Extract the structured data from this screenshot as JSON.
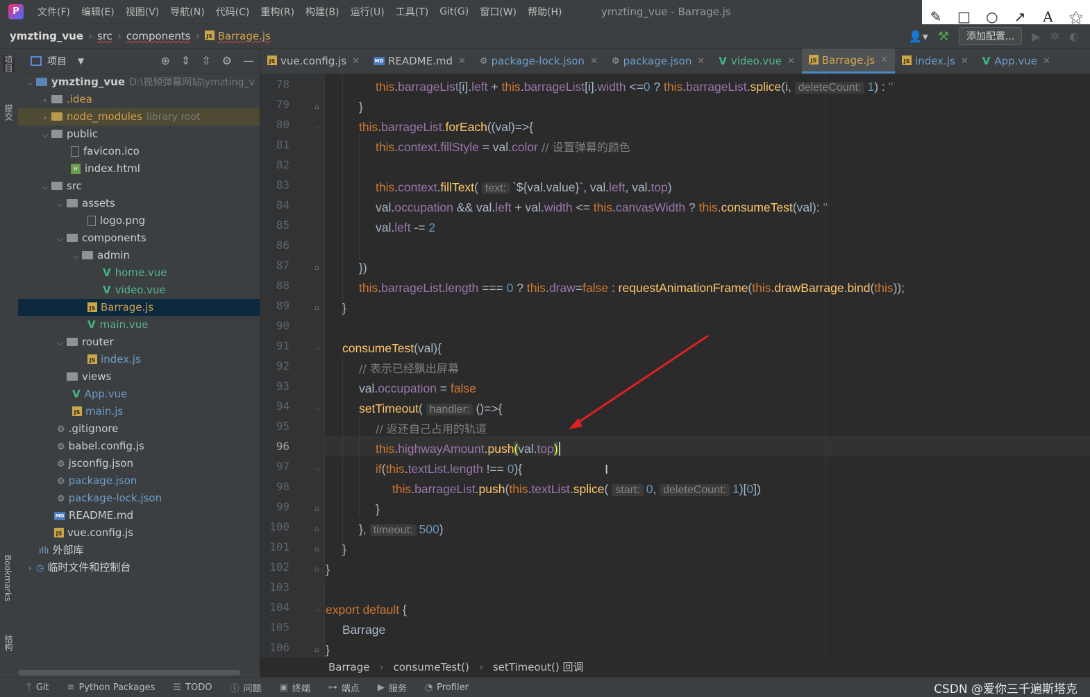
{
  "menubar": {
    "menus": [
      "文件(F)",
      "编辑(E)",
      "视图(V)",
      "导航(N)",
      "代码(C)",
      "重构(R)",
      "构建(B)",
      "运行(U)",
      "工具(T)",
      "Git(G)",
      "窗口(W)",
      "帮助(H)"
    ],
    "window_title": "ymzting_vue - Barrage.js"
  },
  "annotation_toolbar": {
    "tools": [
      "pencil-icon",
      "rectangle-icon",
      "circle-icon",
      "arrow-icon",
      "text-icon",
      "magic-wand-icon"
    ]
  },
  "navbar": {
    "crumbs": [
      "ymzting_vue",
      "src",
      "components",
      "Barrage.js"
    ],
    "add_config_label": "添加配置..."
  },
  "leftstrip": {
    "project": "项目",
    "commit": "提交",
    "bookmarks": "Bookmarks",
    "structure": "结构"
  },
  "project_panel": {
    "title": "项目",
    "tree": [
      {
        "name": "ymzting_vue",
        "extra": "D:\\视频弹幕网站\\ymzting_v"
      },
      {
        "name": ".idea"
      },
      {
        "name": "node_modules",
        "extra": "library root"
      },
      {
        "name": "public"
      },
      {
        "name": "favicon.ico"
      },
      {
        "name": "index.html"
      },
      {
        "name": "src"
      },
      {
        "name": "assets"
      },
      {
        "name": "logo.png"
      },
      {
        "name": "components"
      },
      {
        "name": "admin"
      },
      {
        "name": "home.vue"
      },
      {
        "name": "video.vue"
      },
      {
        "name": "Barrage.js"
      },
      {
        "name": "main.vue"
      },
      {
        "name": "router"
      },
      {
        "name": "index.js"
      },
      {
        "name": "views"
      },
      {
        "name": "App.vue"
      },
      {
        "name": "main.js"
      },
      {
        "name": ".gitignore"
      },
      {
        "name": "babel.config.js"
      },
      {
        "name": "jsconfig.json"
      },
      {
        "name": "package.json"
      },
      {
        "name": "package-lock.json"
      },
      {
        "name": "README.md"
      },
      {
        "name": "vue.config.js"
      },
      {
        "name": "外部库"
      },
      {
        "name": "临时文件和控制台"
      }
    ]
  },
  "tabs": [
    "vue.config.js",
    "README.md",
    "package-lock.json",
    "package.json",
    "video.vue",
    "Barrage.js",
    "index.js",
    "App.vue"
  ],
  "editor": {
    "line_numbers": [
      "78",
      "79",
      "80",
      "81",
      "82",
      "83",
      "84",
      "85",
      "86",
      "87",
      "88",
      "89",
      "90",
      "91",
      "92",
      "93",
      "94",
      "95",
      "96",
      "97",
      "98",
      "99",
      "100",
      "101",
      "102",
      "103",
      "104",
      "105",
      "106"
    ],
    "current_line": "96",
    "code_lines": [
      "this.barrageList[i].left + this.barrageList[i].width <=0 ? this.barrageList.splice(i, deleteCount: 1) : ''",
      "}",
      "this.barrageList.forEach((val)=>{",
      "this.context.fillStyle = val.color // 设置弹幕的颜色",
      "",
      "this.context.fillText( text: `${val.value}`, val.left, val.top)",
      "val.occupation && val.left + val.width <= this.canvasWidth ? this.consumeTest(val): ''",
      "val.left -= 2",
      "",
      "})",
      "this.barrageList.length === 0 ? this.draw=false : requestAnimationFrame(this.drawBarrage.bind(this));",
      "}",
      "",
      "consumeTest(val){",
      "// 表示已经飘出屏幕",
      "val.occupation = false",
      "setTimeout( handler: ()=>{",
      "// 返还自己占用的轨道",
      "this.highwayAmount.push(val.top)",
      "if(this.textList.length !== 0){",
      "this.barrageList.push(this.textList.splice( start: 0, deleteCount: 1)[0])",
      "}",
      "}, timeout: 500)",
      "}",
      "}",
      "",
      "export default {",
      "Barrage",
      "}"
    ]
  },
  "breadcrumb": [
    "Barrage",
    "consumeTest()",
    "setTimeout() 回调"
  ],
  "bottombar": {
    "tools": [
      "Git",
      "Python Packages",
      "TODO",
      "问题",
      "终端",
      "端点",
      "服务",
      "Profiler"
    ],
    "watermark": "CSDN @爱你三千遍斯塔克"
  },
  "colors": {
    "keyword": "#cc7832",
    "function": "#ffc66d",
    "property": "#9876aa",
    "number": "#6897bb",
    "comment": "#808080",
    "annotation_arrow": "#e02020"
  }
}
